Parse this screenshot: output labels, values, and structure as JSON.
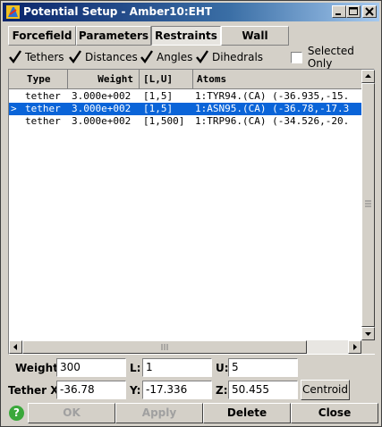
{
  "window": {
    "title": "Potential Setup - Amber10:EHT",
    "icon": "app-logo-icon"
  },
  "tabs": [
    {
      "label": "Forcefield",
      "active": false
    },
    {
      "label": "Parameters",
      "active": false
    },
    {
      "label": "Restraints",
      "active": true
    },
    {
      "label": "Wall",
      "active": false
    }
  ],
  "filters": {
    "tethers": {
      "label": "Tethers",
      "checked": true
    },
    "distances": {
      "label": "Distances",
      "checked": true
    },
    "angles": {
      "label": "Angles",
      "checked": true
    },
    "dihedrals": {
      "label": "Dihedrals",
      "checked": true
    },
    "selected_only": {
      "label": "Selected Only",
      "checked": false
    }
  },
  "table": {
    "columns": [
      "Type",
      "Weight",
      "[L,U]",
      "Atoms"
    ],
    "rows": [
      {
        "marker": "",
        "type": "tether",
        "weight": "3.000e+002",
        "lu": "[1,5]",
        "atoms": "1:TYR94.(CA) (-36.935,-15.",
        "selected": false
      },
      {
        "marker": ">",
        "type": "tether",
        "weight": "3.000e+002",
        "lu": "[1,5]",
        "atoms": "1:ASN95.(CA) (-36.78,-17.3",
        "selected": true
      },
      {
        "marker": "",
        "type": "tether",
        "weight": "3.000e+002",
        "lu": "[1,500]",
        "atoms": "1:TRP96.(CA) (-34.526,-20.",
        "selected": false
      }
    ]
  },
  "form": {
    "weight_label": "Weight:",
    "weight_value": "300",
    "l_label": "L:",
    "l_value": "1",
    "u_label": "U:",
    "u_value": "5",
    "tether_x_label": "Tether X:",
    "tether_x_value": "-36.78",
    "y_label": "Y:",
    "y_value": "-17.336",
    "z_label": "Z:",
    "z_value": "50.455",
    "centroid_label": "Centroid"
  },
  "buttons": {
    "help": "?",
    "ok": "OK",
    "apply": "Apply",
    "delete": "Delete",
    "close": "Close"
  },
  "colors": {
    "title_bar": "#0a246a",
    "selection": "#0a64d8",
    "help_icon": "#3aa83a"
  }
}
